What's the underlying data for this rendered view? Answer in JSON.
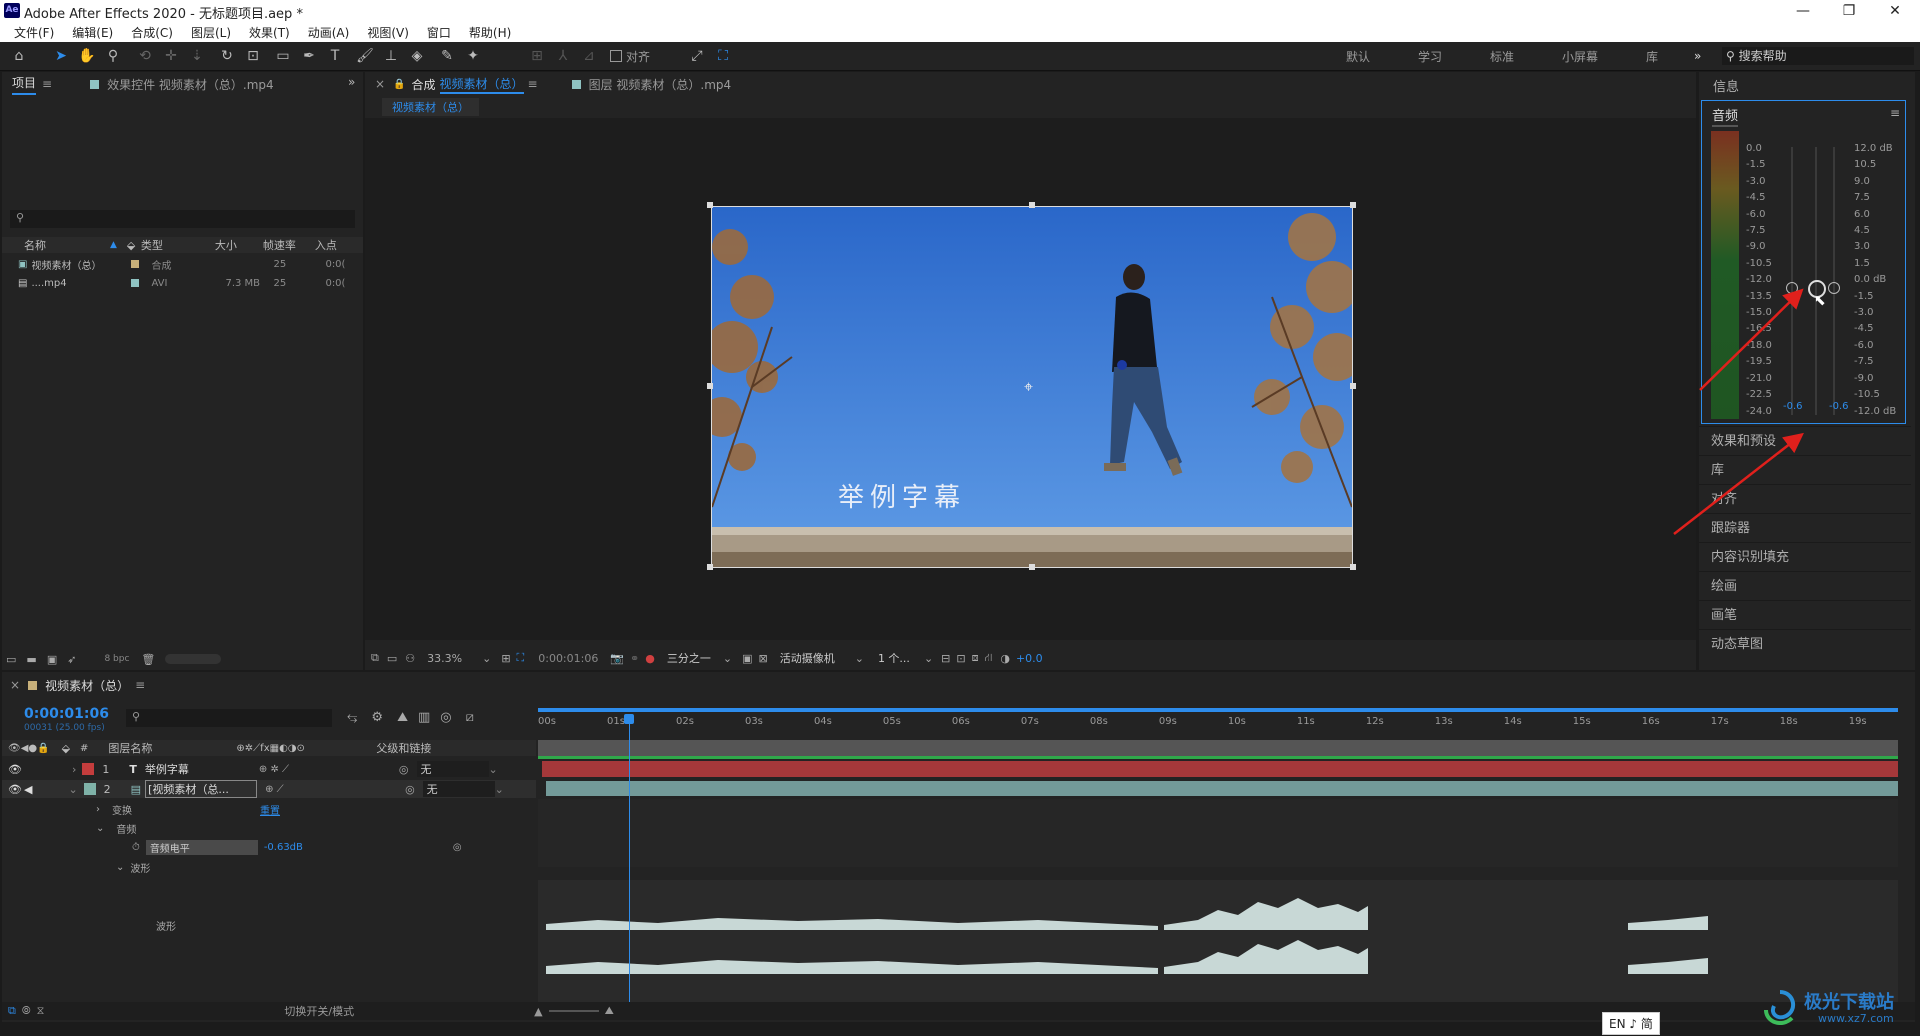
{
  "window": {
    "title": "Adobe After Effects 2020 - 无标题项目.aep *",
    "logo": "Ae",
    "min": "—",
    "max": "❐",
    "close": "✕"
  },
  "menu": [
    "文件(F)",
    "编辑(E)",
    "合成(C)",
    "图层(L)",
    "效果(T)",
    "动画(A)",
    "视图(V)",
    "窗口",
    "帮助(H)"
  ],
  "toolbar": {
    "align_label": "对齐",
    "workspaces": [
      "默认",
      "学习",
      "标准",
      "小屏幕",
      "库"
    ],
    "more": "»",
    "help_placeholder": "搜索帮助"
  },
  "project": {
    "tab_project": "项目",
    "tab_effects": "效果控件 视频素材（总）.mp4",
    "search_placeholder": "",
    "columns": [
      "名称",
      "类型",
      "大小",
      "帧速率",
      "入点"
    ],
    "items": [
      {
        "name": "视频素材（总）",
        "type": "合成",
        "size": "",
        "fps": "25",
        "in": "0:0("
      },
      {
        "name": "....mp4",
        "type": "AVI",
        "size": "7.3 MB",
        "fps": "25",
        "in": "0:0("
      }
    ],
    "bpc": "8 bpc"
  },
  "viewer": {
    "tab_comp": "合成",
    "tab_comp_name": "视频素材（总）",
    "tab_layer": "图层 视频素材（总）.mp4",
    "breadcrumb": "视频素材（总）",
    "subtitle": "举例字幕",
    "zoom": "33.3%",
    "timecode": "0:00:01:06",
    "guides": "三分之一",
    "camera": "活动摄像机",
    "views": "1 个...",
    "exposure": "+0.0"
  },
  "right": {
    "info": "信息",
    "audio_title": "音频",
    "db_left": [
      "0.0",
      "-1.5",
      "-3.0",
      "-4.5",
      "-6.0",
      "-7.5",
      "-9.0",
      "-10.5",
      "-12.0",
      "-13.5",
      "-15.0",
      "-16.5",
      "-18.0",
      "-19.5",
      "-21.0",
      "-22.5",
      "-24.0"
    ],
    "db_right": [
      "12.0 dB",
      "10.5",
      "9.0",
      "7.5",
      "6.0",
      "4.5",
      "3.0",
      "1.5",
      "0.0 dB",
      "-1.5",
      "-3.0",
      "-4.5",
      "-6.0",
      "-7.5",
      "-9.0",
      "-10.5",
      "-12.0 dB"
    ],
    "level_left": "-0.6",
    "level_right": "-0.6",
    "panels": [
      "效果和预设",
      "库",
      "对齐",
      "跟踪器",
      "内容识别填充",
      "绘画",
      "画笔",
      "动态草图"
    ]
  },
  "timeline": {
    "comp_name": "视频素材（总）",
    "timecode": "0:00:01:06",
    "frame_info": "00031 (25.00 fps)",
    "col_layer_name": "图层名称",
    "col_parent": "父级和链接",
    "col_num": "#",
    "layers": [
      {
        "num": "1",
        "name": "举例字幕",
        "parent": "无",
        "color": "#c43d3d"
      },
      {
        "num": "2",
        "name": "[视频素材（总...",
        "parent": "无",
        "color": "#7fb2a8"
      }
    ],
    "props": {
      "transform": "变换",
      "reset": "重置",
      "audio": "音频",
      "audio_level": "音频电平",
      "audio_level_val": "-0.63dB",
      "waveform_group": "波形",
      "waveform": "波形"
    },
    "ticks": [
      "00s",
      "01s",
      "02s",
      "03s",
      "04s",
      "05s",
      "06s",
      "07s",
      "08s",
      "09s",
      "10s",
      "11s",
      "12s",
      "13s",
      "14s",
      "15s",
      "16s",
      "17s",
      "18s",
      "19s"
    ],
    "footer_toggle": "切换开关/模式",
    "ime": "EN ♪ 简"
  },
  "watermark": {
    "text": "极光下载站",
    "url": "www.xz7.com"
  }
}
